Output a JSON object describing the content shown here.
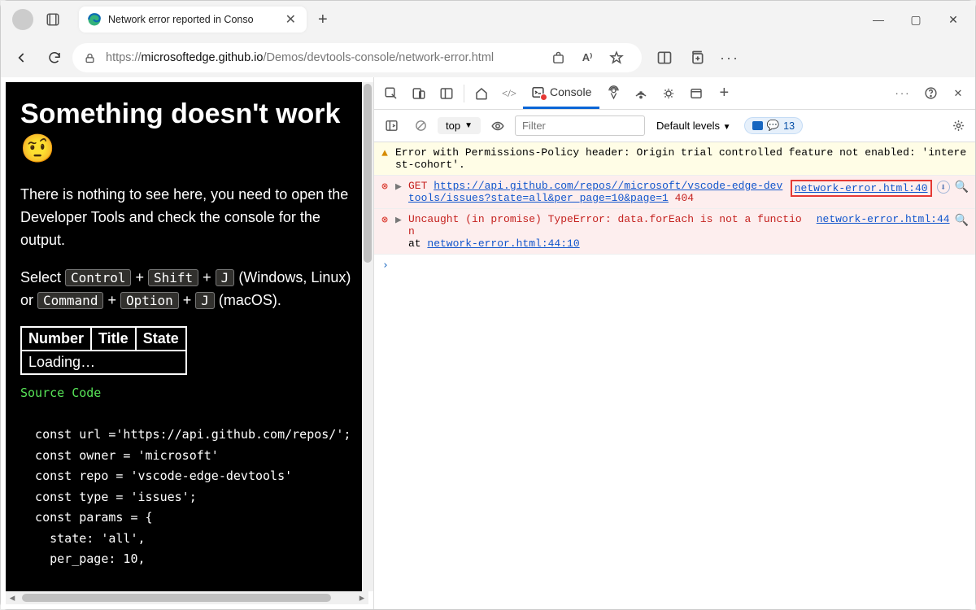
{
  "chrome": {
    "tab_title": "Network error reported in Conso",
    "url_proto": "https://",
    "url_host": "microsoftedge.github.io",
    "url_path": "/Demos/devtools-console/network-error.html"
  },
  "page": {
    "heading": "Something doesn't work 🤨",
    "para": "There is nothing to see here, you need to open the Developer Tools and check the console for the output.",
    "sel_prefix": "Select ",
    "kbd_ctrl": "Control",
    "kbd_shift": "Shift",
    "kbd_j": "J",
    "winlinux": " (Windows, Linux) or ",
    "kbd_cmd": "Command",
    "kbd_opt": "Option",
    "macos": " (macOS).",
    "th_num": "Number",
    "th_title": "Title",
    "th_state": "State",
    "loading": "Loading…",
    "code_head": "Source Code",
    "code": "\n  const url ='https://api.github.com/repos/';\n  const owner = 'microsoft'\n  const repo = 'vscode-edge-devtools'\n  const type = 'issues';\n  const params = {\n    state: 'all',\n    per_page: 10,"
  },
  "devtools": {
    "tab_console": "Console",
    "context": "top",
    "filter_placeholder": "Filter",
    "levels": "Default levels",
    "issue_count": "13",
    "msg_warn": "Error with Permissions-Policy header: Origin trial controlled feature not enabled: 'interest-cohort'.",
    "msg_err1_method": "GET",
    "msg_err1_url": "https://api.github.com/repos//microsoft/vscode-edge-devtools/issues?state=all&per_page=10&page=1",
    "msg_err1_status": "404",
    "msg_err1_src": "network-error.html:40",
    "msg_err2_pre": "Uncaught (in promise) TypeError: data.forEach is not a function",
    "msg_err2_at": "    at ",
    "msg_err2_loc": "network-error.html:44:10",
    "msg_err2_src": "network-error.html:44"
  }
}
